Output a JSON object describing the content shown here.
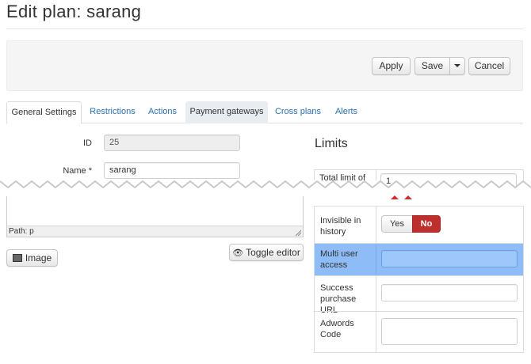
{
  "page": {
    "title": "Edit plan: sarang"
  },
  "toolbar": {
    "apply_label": "Apply",
    "save_label": "Save",
    "cancel_label": "Cancel"
  },
  "tabs": [
    {
      "label": "General Settings",
      "active": true
    },
    {
      "label": "Restrictions"
    },
    {
      "label": "Actions"
    },
    {
      "label": "Payment gateways"
    },
    {
      "label": "Cross plans"
    },
    {
      "label": "Alerts"
    }
  ],
  "form": {
    "id_label": "ID",
    "id_value": "25",
    "name_label": "Name *",
    "name_value": "sarang"
  },
  "editor": {
    "path_text": "Path: p",
    "image_button": "Image",
    "toggle_button": "Toggle editor"
  },
  "limits": {
    "heading": "Limits",
    "total_limit_label": "Total limit of",
    "total_limit_value": "1",
    "invisible_label": "Invisible in history",
    "yes_label": "Yes",
    "no_label": "No",
    "invisible_selected": "No",
    "multi_user_label": "Multi user access",
    "success_url_label": "Success purchase URL",
    "adwords_label": "Adwords Code"
  },
  "colors": {
    "accent_link": "#2a6fb0",
    "no_active": "#bd2f2c",
    "highlight_row": "#8ebcf6"
  }
}
